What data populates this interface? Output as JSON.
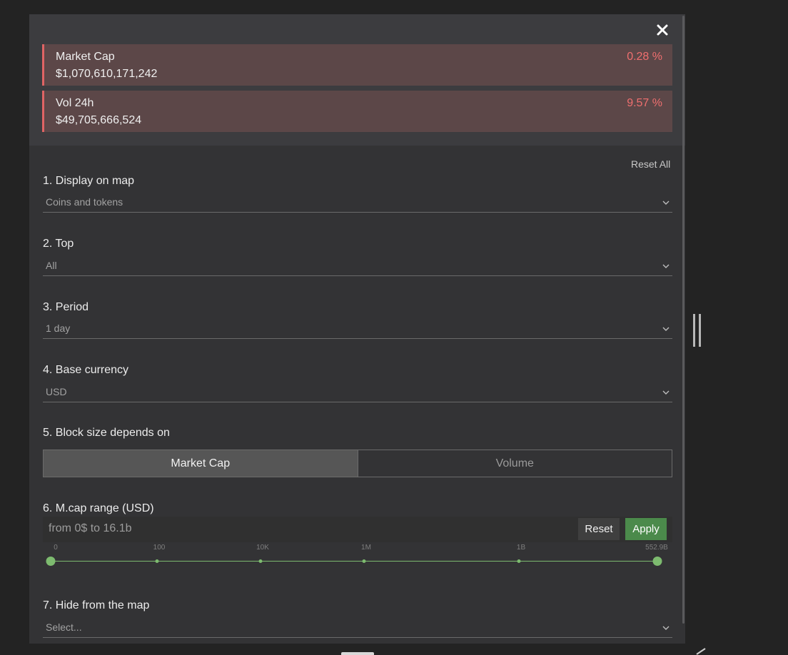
{
  "stats": [
    {
      "label": "Market Cap",
      "value": "$1,070,610,171,242",
      "change": "0.28 %"
    },
    {
      "label": "Vol 24h",
      "value": "$49,705,666,524",
      "change": "9.57 %"
    }
  ],
  "reset_all_label": "Reset All",
  "sections": {
    "display": {
      "title": "1. Display on map",
      "value": "Coins and tokens"
    },
    "top": {
      "title": "2. Top",
      "value": "All"
    },
    "period": {
      "title": "3. Period",
      "value": "1 day"
    },
    "currency": {
      "title": "4. Base currency",
      "value": "USD"
    },
    "block_size": {
      "title": "5. Block size depends on",
      "options": [
        "Market Cap",
        "Volume"
      ],
      "selected": "Market Cap"
    },
    "mcap_range": {
      "title": "6. M.cap range (USD)",
      "range_text": "from 0$ to 16.1b",
      "reset_label": "Reset",
      "apply_label": "Apply",
      "ticks": [
        "0",
        "100",
        "10K",
        "1M",
        "1B",
        "552.9B"
      ],
      "selected_min": "0",
      "selected_max": "552.9B"
    },
    "hide": {
      "title": "7. Hide from the map",
      "placeholder": "Select..."
    }
  },
  "colors": {
    "negative": "#ef6f6f",
    "accent_green": "#4b8a4b",
    "slider_green": "#7dbb6f"
  },
  "icons": {
    "close": "close-icon",
    "dropdown": "chevron-down-icon"
  }
}
